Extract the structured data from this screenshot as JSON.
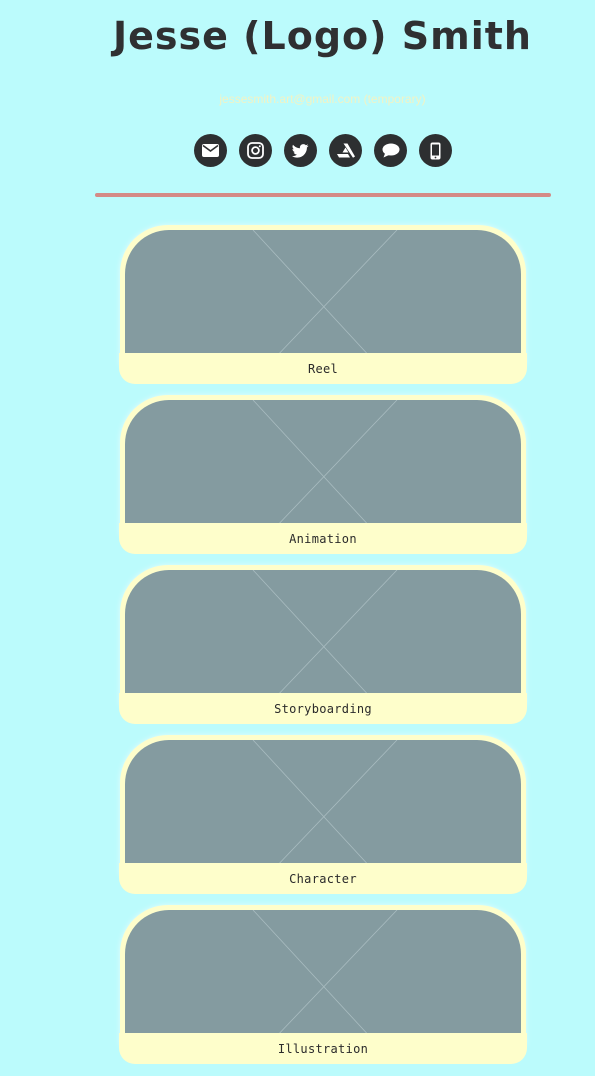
{
  "header": {
    "title": "Jesse (Logo) Smith",
    "email": "jessesmith.art@gmail.com (temporary)"
  },
  "social": [
    {
      "name": "email",
      "icon": "envelope-icon"
    },
    {
      "name": "instagram",
      "icon": "instagram-icon"
    },
    {
      "name": "twitter",
      "icon": "twitter-icon"
    },
    {
      "name": "artstation",
      "icon": "artstation-icon"
    },
    {
      "name": "message",
      "icon": "chat-bubble-icon"
    },
    {
      "name": "phone",
      "icon": "mobile-phone-icon"
    }
  ],
  "cards": [
    {
      "label": "Reel"
    },
    {
      "label": "Animation"
    },
    {
      "label": "Storyboarding"
    },
    {
      "label": "Character"
    },
    {
      "label": "Illustration"
    }
  ],
  "colors": {
    "background": "#bbfbfc",
    "title": "#2f3032",
    "email": "#f3f3c4",
    "divider": "#d48a86",
    "card_frame": "#fefecb",
    "thumbnail": "#849ba0",
    "icon_bg": "#2d2f31"
  }
}
